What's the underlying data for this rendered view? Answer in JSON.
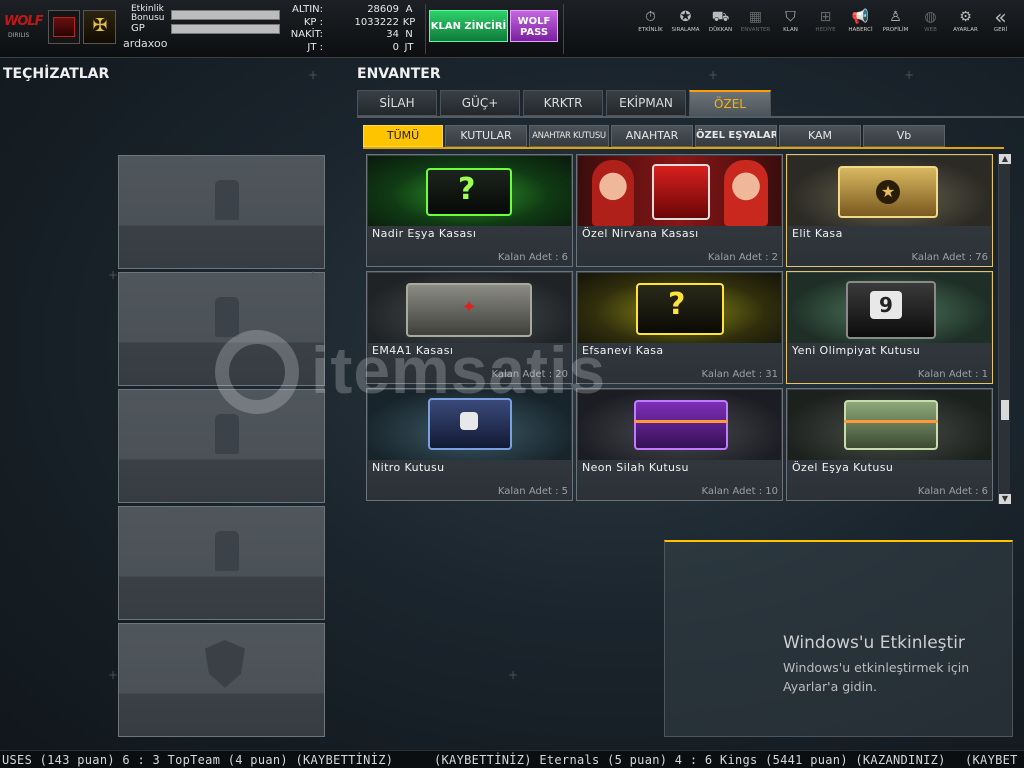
{
  "header": {
    "logo_text": "WOLF",
    "logo_sub": "DIRILIS",
    "event_bonus_label": "Etkinlik Bonusu",
    "gp_label": "GP",
    "username": "ardaxoo",
    "currency": [
      {
        "label": "ALTIN:",
        "value": "28609",
        "unit": "A"
      },
      {
        "label": "KP :",
        "value": "1033222",
        "unit": "KP"
      },
      {
        "label": "NAKİT:",
        "value": "34",
        "unit": "N"
      },
      {
        "label": "JT :",
        "value": "0",
        "unit": "JT"
      }
    ],
    "klan_button": "KLAN ZİNCİRİ",
    "wolf_pass": "WOLF PASS",
    "nav": [
      {
        "label": "ETKİNLİK",
        "icon": "stopwatch-icon",
        "glyph": "⏱"
      },
      {
        "label": "SIRALAMA",
        "icon": "medal-icon",
        "glyph": "✪"
      },
      {
        "label": "DÜKKAN",
        "icon": "cart-icon",
        "glyph": "⛟"
      },
      {
        "label": "ENVANTER",
        "icon": "inventory-icon",
        "glyph": "▦"
      },
      {
        "label": "KLAN",
        "icon": "clan-shield-icon",
        "glyph": "⛉"
      },
      {
        "label": "HEDİYE",
        "icon": "gift-icon",
        "glyph": "⊞"
      },
      {
        "label": "HABERCİ",
        "icon": "megaphone-icon",
        "glyph": "📢"
      },
      {
        "label": "PROFİLİM",
        "icon": "profile-icon",
        "glyph": "♙"
      },
      {
        "label": "WEB",
        "icon": "globe-icon",
        "glyph": "◍"
      },
      {
        "label": "AYARLAR",
        "icon": "gear-icon",
        "glyph": "⚙"
      },
      {
        "label": "GERİ",
        "icon": "back-icon",
        "glyph": "«"
      }
    ]
  },
  "left": {
    "title": "TEÇHİZATLAR"
  },
  "inventory": {
    "title": "ENVANTER",
    "main_tabs": [
      "SİLAH",
      "GÜÇ+",
      "KRKTR",
      "EKİPMAN",
      "ÖZEL"
    ],
    "sub_tabs": [
      "TÜMÜ",
      "KUTULAR",
      "ANAHTAR KUTUSU",
      "ANAHTAR",
      "ÖZEL EŞYALAR",
      "KAM",
      "Vb"
    ],
    "items": [
      {
        "name": "Nadir Eşya Kasası",
        "remaining": "Kalan Adet : 6"
      },
      {
        "name": "Özel Nirvana Kasası",
        "remaining": "Kalan Adet : 2"
      },
      {
        "name": "Elit Kasa",
        "remaining": "Kalan Adet : 76"
      },
      {
        "name": "EM4A1 Kasası",
        "remaining": "Kalan Adet : 20"
      },
      {
        "name": "Efsanevi Kasa",
        "remaining": "Kalan Adet : 31"
      },
      {
        "name": "Yeni Olimpiyat Kutusu",
        "remaining": "Kalan Adet : 1"
      },
      {
        "name": "Nitro Kutusu",
        "remaining": "Kalan Adet : 5"
      },
      {
        "name": "Neon Silah Kutusu",
        "remaining": "Kalan Adet : 10"
      },
      {
        "name": "Özel Eşya Kutusu",
        "remaining": "Kalan Adet : 6"
      }
    ]
  },
  "activation": {
    "title": "Windows'u Etkinleştir",
    "line1": "Windows'u etkinleştirmek için",
    "line2": "Ayarlar'a gidin."
  },
  "watermark": "itemsatis",
  "ticker": {
    "part1": "USES (143 puan) 6 : 3 TopTeam (4 puan) (KAYBETTİNİZ)",
    "part2": "(KAYBETTİNİZ) Eternals (5 puan) 4 : 6 Kings (5441 puan) (KAZANDINIZ)",
    "part3": "(KAYBET"
  },
  "colors": {
    "accent": "#ffc400",
    "klan_green": "#1faa55",
    "wolf_purple": "#a23fc8"
  }
}
